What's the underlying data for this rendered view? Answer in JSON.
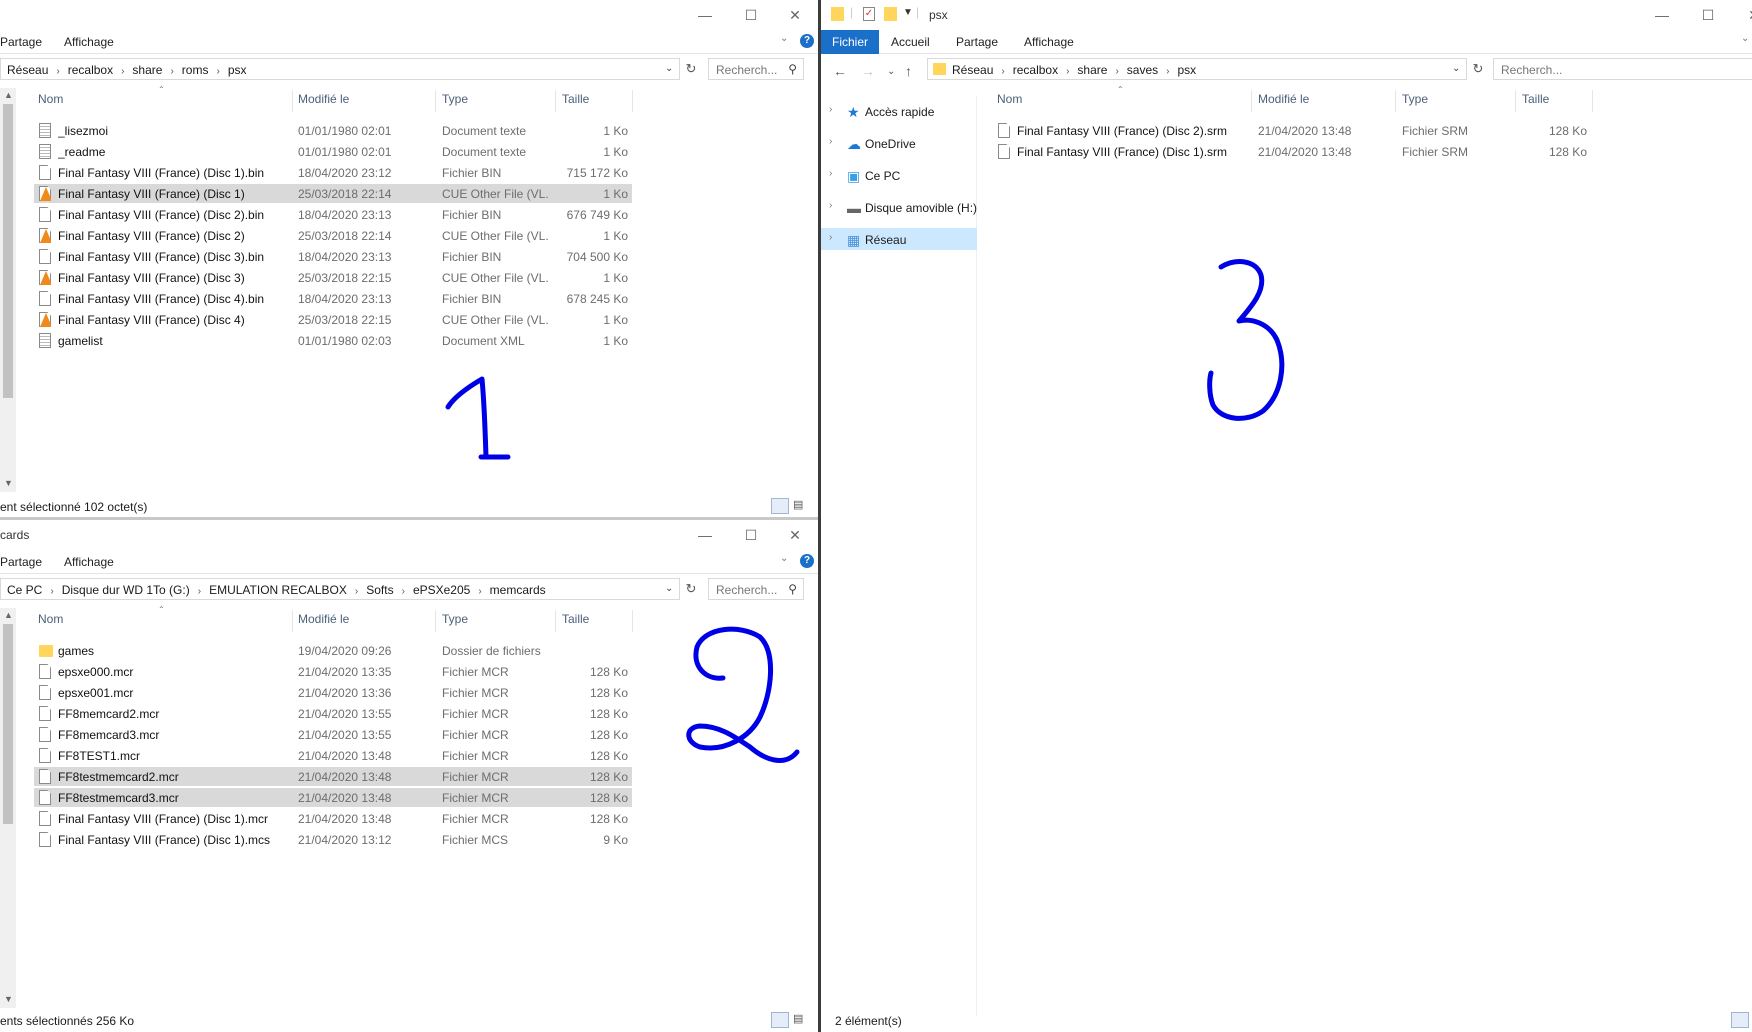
{
  "win1": {
    "ribbon": {
      "partage": "Partage",
      "affichage": "Affichage"
    },
    "path": [
      "Réseau",
      "recalbox",
      "share",
      "roms",
      "psx"
    ],
    "search_placeholder": "Recherch...",
    "columns": {
      "name": "Nom",
      "date": "Modifié le",
      "type": "Type",
      "size": "Taille"
    },
    "rows": [
      {
        "name": "_lisezmoi",
        "date": "01/01/1980 02:01",
        "type": "Document texte",
        "size": "1 Ko",
        "icon": "text-file-icon"
      },
      {
        "name": "_readme",
        "date": "01/01/1980 02:01",
        "type": "Document texte",
        "size": "1 Ko",
        "icon": "text-file-icon"
      },
      {
        "name": "Final Fantasy VIII (France) (Disc 1).bin",
        "date": "18/04/2020 23:12",
        "type": "Fichier BIN",
        "size": "715 172 Ko",
        "icon": "file-icon"
      },
      {
        "name": "Final Fantasy VIII (France) (Disc 1)",
        "date": "25/03/2018 22:14",
        "type": "CUE Other File (VL...",
        "size": "1 Ko",
        "icon": "vlc-cone-icon",
        "selected": true
      },
      {
        "name": "Final Fantasy VIII (France) (Disc 2).bin",
        "date": "18/04/2020 23:13",
        "type": "Fichier BIN",
        "size": "676 749 Ko",
        "icon": "file-icon"
      },
      {
        "name": "Final Fantasy VIII (France) (Disc 2)",
        "date": "25/03/2018 22:14",
        "type": "CUE Other File (VL...",
        "size": "1 Ko",
        "icon": "vlc-cone-icon"
      },
      {
        "name": "Final Fantasy VIII (France) (Disc 3).bin",
        "date": "18/04/2020 23:13",
        "type": "Fichier BIN",
        "size": "704 500 Ko",
        "icon": "file-icon"
      },
      {
        "name": "Final Fantasy VIII (France) (Disc 3)",
        "date": "25/03/2018 22:15",
        "type": "CUE Other File (VL...",
        "size": "1 Ko",
        "icon": "vlc-cone-icon"
      },
      {
        "name": "Final Fantasy VIII (France) (Disc 4).bin",
        "date": "18/04/2020 23:13",
        "type": "Fichier BIN",
        "size": "678 245 Ko",
        "icon": "file-icon"
      },
      {
        "name": "Final Fantasy VIII (France) (Disc 4)",
        "date": "25/03/2018 22:15",
        "type": "CUE Other File (VL...",
        "size": "1 Ko",
        "icon": "vlc-cone-icon"
      },
      {
        "name": "gamelist",
        "date": "01/01/1980 02:03",
        "type": "Document XML",
        "size": "1 Ko",
        "icon": "xml-file-icon"
      }
    ],
    "status": "ent sélectionné  102 octet(s)"
  },
  "win2": {
    "title": "cards",
    "ribbon": {
      "partage": "Partage",
      "affichage": "Affichage"
    },
    "path": [
      "Ce PC",
      "Disque dur WD 1To (G:)",
      "EMULATION RECALBOX",
      "Softs",
      "ePSXe205",
      "memcards"
    ],
    "search_placeholder": "Recherch...",
    "columns": {
      "name": "Nom",
      "date": "Modifié le",
      "type": "Type",
      "size": "Taille"
    },
    "rows": [
      {
        "name": "games",
        "date": "19/04/2020 09:26",
        "type": "Dossier de fichiers",
        "size": "",
        "icon": "folder-icon"
      },
      {
        "name": "epsxe000.mcr",
        "date": "21/04/2020 13:35",
        "type": "Fichier MCR",
        "size": "128 Ko",
        "icon": "file-icon"
      },
      {
        "name": "epsxe001.mcr",
        "date": "21/04/2020 13:36",
        "type": "Fichier MCR",
        "size": "128 Ko",
        "icon": "file-icon"
      },
      {
        "name": "FF8memcard2.mcr",
        "date": "21/04/2020 13:55",
        "type": "Fichier MCR",
        "size": "128 Ko",
        "icon": "file-icon"
      },
      {
        "name": "FF8memcard3.mcr",
        "date": "21/04/2020 13:55",
        "type": "Fichier MCR",
        "size": "128 Ko",
        "icon": "file-icon"
      },
      {
        "name": "FF8TEST1.mcr",
        "date": "21/04/2020 13:48",
        "type": "Fichier MCR",
        "size": "128 Ko",
        "icon": "file-icon"
      },
      {
        "name": "FF8testmemcard2.mcr",
        "date": "21/04/2020 13:48",
        "type": "Fichier MCR",
        "size": "128 Ko",
        "icon": "file-icon",
        "selected": true
      },
      {
        "name": "FF8testmemcard3.mcr",
        "date": "21/04/2020 13:48",
        "type": "Fichier MCR",
        "size": "128 Ko",
        "icon": "file-icon",
        "selected": true
      },
      {
        "name": "Final Fantasy VIII (France) (Disc 1).mcr",
        "date": "21/04/2020 13:48",
        "type": "Fichier MCR",
        "size": "128 Ko",
        "icon": "file-icon"
      },
      {
        "name": "Final Fantasy VIII (France) (Disc 1).mcs",
        "date": "21/04/2020 13:12",
        "type": "Fichier MCS",
        "size": "9 Ko",
        "icon": "file-icon"
      }
    ],
    "status": "ents sélectionnés  256 Ko"
  },
  "win3": {
    "title": "psx",
    "ribbon": {
      "fichier": "Fichier",
      "accueil": "Accueil",
      "partage": "Partage",
      "affichage": "Affichage"
    },
    "path": [
      "Réseau",
      "recalbox",
      "share",
      "saves",
      "psx"
    ],
    "search_placeholder": "Recherch...",
    "nav": [
      {
        "label": "Accès rapide",
        "icon": "star-icon"
      },
      {
        "label": "OneDrive",
        "icon": "cloud-icon"
      },
      {
        "label": "Ce PC",
        "icon": "computer-icon"
      },
      {
        "label": "Disque amovible (H:)",
        "icon": "drive-icon"
      },
      {
        "label": "Réseau",
        "icon": "network-icon",
        "selected": true
      }
    ],
    "columns": {
      "name": "Nom",
      "date": "Modifié le",
      "type": "Type",
      "size": "Taille"
    },
    "rows": [
      {
        "name": "Final Fantasy VIII (France) (Disc 2).srm",
        "date": "21/04/2020 13:48",
        "type": "Fichier SRM",
        "size": "128 Ko",
        "icon": "file-icon"
      },
      {
        "name": "Final Fantasy VIII (France) (Disc 1).srm",
        "date": "21/04/2020 13:48",
        "type": "Fichier SRM",
        "size": "128 Ko",
        "icon": "file-icon"
      }
    ],
    "status": "2 élément(s)"
  },
  "annotations": {
    "one": "1",
    "two": "2",
    "three": "3",
    "color": "#0000e6"
  },
  "accent": "#1a6fc9",
  "selection_color": "#d9d9d9"
}
